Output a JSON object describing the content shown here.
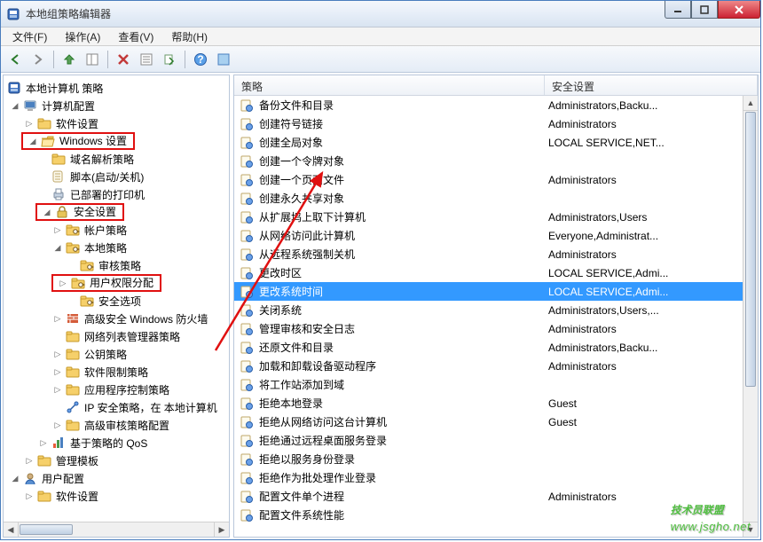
{
  "window": {
    "title": "本地组策略编辑器"
  },
  "menu": {
    "file": "文件(F)",
    "action": "操作(A)",
    "view": "查看(V)",
    "help": "帮助(H)"
  },
  "tree_root": "本地计算机 策略",
  "tree": {
    "computer_cfg": "计算机配置",
    "software": "软件设置",
    "windows_settings": "Windows 设置",
    "name_res": "域名解析策略",
    "script": "脚本(启动/关机)",
    "deployed_printers": "已部署的打印机",
    "security_settings": "安全设置",
    "account_policies": "帐户策略",
    "local_policies": "本地策略",
    "audit_policy": "审核策略",
    "user_rights": "用户权限分配",
    "security_options": "安全选项",
    "adv_firewall": "高级安全 Windows 防火墙",
    "nlm": "网络列表管理器策略",
    "pk": "公钥策略",
    "srp": "软件限制策略",
    "acp": "应用程序控制策略",
    "ipsec": "IP 安全策略，在 本地计算机",
    "adv_audit": "高级审核策略配置",
    "qos": "基于策略的 QoS",
    "admin_tmpl": "管理模板",
    "user_cfg": "用户配置",
    "software2": "软件设置"
  },
  "list_header": {
    "policy": "策略",
    "security": "安全设置"
  },
  "policies": [
    {
      "name": "备份文件和目录",
      "sec": "Administrators,Backu..."
    },
    {
      "name": "创建符号链接",
      "sec": "Administrators"
    },
    {
      "name": "创建全局对象",
      "sec": "LOCAL SERVICE,NET..."
    },
    {
      "name": "创建一个令牌对象",
      "sec": ""
    },
    {
      "name": "创建一个页面文件",
      "sec": "Administrators"
    },
    {
      "name": "创建永久共享对象",
      "sec": ""
    },
    {
      "name": "从扩展坞上取下计算机",
      "sec": "Administrators,Users"
    },
    {
      "name": "从网络访问此计算机",
      "sec": "Everyone,Administrat..."
    },
    {
      "name": "从远程系统强制关机",
      "sec": "Administrators"
    },
    {
      "name": "更改时区",
      "sec": "LOCAL SERVICE,Admi..."
    },
    {
      "name": "更改系统时间",
      "sec": "LOCAL SERVICE,Admi...",
      "selected": true
    },
    {
      "name": "关闭系统",
      "sec": "Administrators,Users,..."
    },
    {
      "name": "管理审核和安全日志",
      "sec": "Administrators"
    },
    {
      "name": "还原文件和目录",
      "sec": "Administrators,Backu..."
    },
    {
      "name": "加载和卸载设备驱动程序",
      "sec": "Administrators"
    },
    {
      "name": "将工作站添加到域",
      "sec": ""
    },
    {
      "name": "拒绝本地登录",
      "sec": "Guest"
    },
    {
      "name": "拒绝从网络访问这台计算机",
      "sec": "Guest"
    },
    {
      "name": "拒绝通过远程桌面服务登录",
      "sec": ""
    },
    {
      "name": "拒绝以服务身份登录",
      "sec": ""
    },
    {
      "name": "拒绝作为批处理作业登录",
      "sec": ""
    },
    {
      "name": "配置文件单个进程",
      "sec": "Administrators"
    },
    {
      "name": "配置文件系统性能",
      "sec": ""
    }
  ],
  "watermark": {
    "main": "技术员联盟",
    "sub": "www.jsgho.net"
  }
}
